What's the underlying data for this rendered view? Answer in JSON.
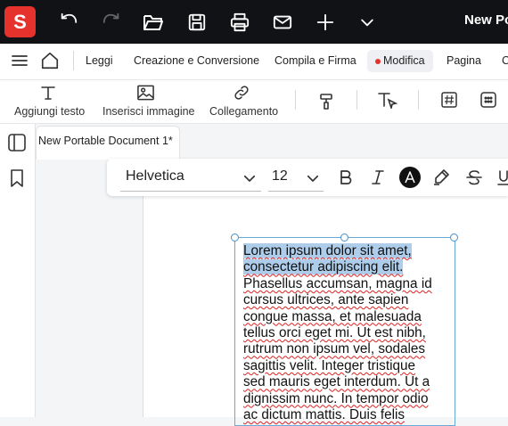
{
  "app": {
    "logo_letter": "S",
    "document_title": "New Po"
  },
  "topbar_icons": [
    "undo-icon",
    "redo-icon",
    "open-folder-icon",
    "save-icon",
    "print-icon",
    "mail-icon",
    "plus-icon",
    "chevron-down-icon"
  ],
  "menu": {
    "items": [
      {
        "label": "Leggi"
      },
      {
        "label": "Creazione e Conversione"
      },
      {
        "label": "Compila e Firma"
      },
      {
        "label": "Modifica",
        "active": true
      },
      {
        "label": "Pagina"
      },
      {
        "label": "C"
      }
    ]
  },
  "toolbar": {
    "add_text": "Aggiungi testo",
    "insert_image": "Inserisci immagine",
    "link": "Collegamento"
  },
  "tab": {
    "label": "New Portable Document 1*"
  },
  "format": {
    "font": "Helvetica",
    "size": "12"
  },
  "textbox": {
    "lines": [
      "Lorem ipsum dolor sit amet,",
      "consectetur adipiscing elit.",
      "Phasellus accumsan, magna id",
      "cursus ultrices, ante sapien",
      "congue massa, et malesuada",
      "tellus orci eget mi. Ut est nibh,",
      "rutrum non ipsum vel, sodales",
      "sagittis velit. Integer tristique",
      "sed mauris eget interdum. Ut a",
      "dignissim nunc. In tempor odio",
      "ac dictum mattis. Duis felis"
    ]
  },
  "colors": {
    "accent": "#e5322d",
    "topbar": "#111216",
    "selection": "#aecdeb"
  }
}
